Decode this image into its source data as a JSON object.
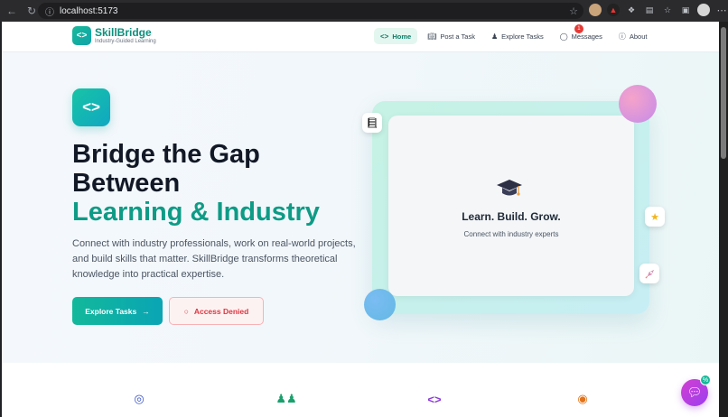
{
  "browser": {
    "url": "localhost:5173"
  },
  "header": {
    "logo_icon": "code-brackets-icon",
    "brand": "SkillBridge",
    "tagline": "Industry-Guided Learning",
    "nav": [
      {
        "label": "Home",
        "icon": "code-brackets-icon",
        "active": true
      },
      {
        "label": "Post a Task",
        "icon": "book-icon"
      },
      {
        "label": "Explore Tasks",
        "icon": "users-icon"
      },
      {
        "label": "Messages",
        "icon": "chat-icon",
        "badge": "1"
      },
      {
        "label": "About",
        "icon": "info-icon"
      }
    ]
  },
  "hero": {
    "title_line1": "Bridge the Gap",
    "title_line2": "Between",
    "title_accent": "Learning & Industry",
    "description": "Connect with industry professionals, work on real-world projects, and build skills that matter. SkillBridge transforms theoretical knowledge into practical expertise.",
    "primary_button": "Explore Tasks",
    "secondary_button": "Access Denied"
  },
  "showcase": {
    "title": "Learn. Build. Grow.",
    "subtitle": "Connect with industry experts"
  },
  "features": {
    "icons": [
      "target-icon",
      "users-icon",
      "code-brackets-icon",
      "award-icon"
    ]
  },
  "chat": {
    "badge": "%"
  },
  "colors": {
    "brand": "#0e9b86",
    "accent_gradient_start": "#12b89a",
    "accent_gradient_end": "#0aa5b5",
    "danger": "#e0353f",
    "badge": "#e53935"
  }
}
